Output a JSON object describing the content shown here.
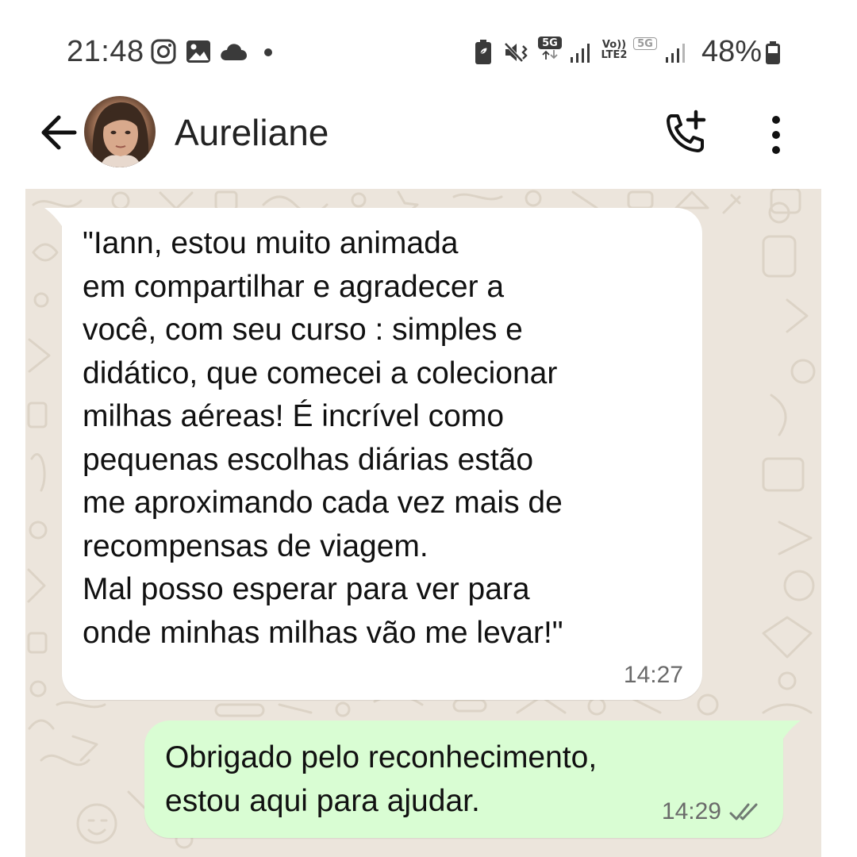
{
  "status_bar": {
    "time": "21:48",
    "left_icons": [
      "instagram-icon",
      "gallery-icon",
      "cloud-icon",
      "dot-icon"
    ],
    "right_icons": [
      "battery-saver-icon",
      "mute-vibrate-icon",
      "5g-icon",
      "signal-icon",
      "volte-icon",
      "5g-icon",
      "signal-icon",
      "battery-icon"
    ],
    "net_5g": "5G",
    "net_volte_top": "Vo))",
    "net_volte_bottom": "LTE2",
    "net_5g_second": "5G",
    "battery": "48%"
  },
  "header": {
    "contact_name": "Aureliane",
    "back_icon": "back-arrow-icon",
    "call_icon": "add-call-icon",
    "menu_icon": "more-vertical-icon"
  },
  "messages": [
    {
      "direction": "incoming",
      "text": "\"Iann, estou muito animada\nem compartilhar e agradecer a\nvocê, com seu  curso : simples e\ndidático,  que comecei a colecionar\nmilhas aéreas! É incrível como\npequenas escolhas diárias estão\nme aproximando cada vez mais de\nrecompensas de viagem.\nMal posso esperar para ver para\nonde minhas milhas vão me levar!\"",
      "time": "14:27"
    },
    {
      "direction": "outgoing",
      "text": "Obrigado pelo reconhecimento,\nestou aqui para ajudar.",
      "time": "14:29",
      "status_icon": "double-check-icon"
    }
  ],
  "colors": {
    "chat_background": "#ece5dc",
    "incoming_bubble": "#ffffff",
    "outgoing_bubble": "#d9fdd3",
    "text": "#111111",
    "timestamp": "#6a6a6a"
  }
}
